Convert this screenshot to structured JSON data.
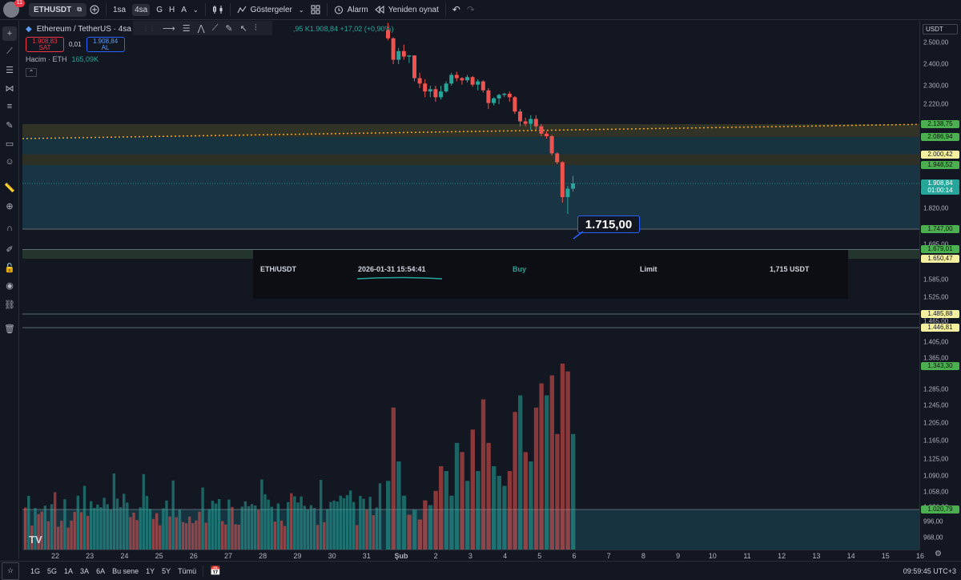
{
  "header": {
    "badge_count": "11",
    "symbol": "ETHUSDT",
    "timeframes": [
      "1sa",
      "4sa",
      "G",
      "H",
      "A"
    ],
    "active_timeframe": "4sa",
    "indicators_label": "Göstergeler",
    "alarm_label": "Alarm",
    "replay_label": "Yeniden oynat"
  },
  "legend": {
    "title": "Ethereum / TetherUS · 4sa",
    "ohlc_tail": ",95 K1.908,84 +17,02 (+0,90%)",
    "sell_price": "1.908,83",
    "sell_label": "SAT",
    "spread": "0,01",
    "buy_price": "1.908,84",
    "buy_label": "AL",
    "volume_label": "Hacim · ETH",
    "volume_value": "165,09K"
  },
  "axis": {
    "currency": "USDT",
    "labels": [
      "2.500,00",
      "2.400,00",
      "2.300,00",
      "2.220,00",
      "2.080,00",
      "1.950,00",
      "1.820,00",
      "1.695,00",
      "1.585,00",
      "1.525,00",
      "1.465,00",
      "1.405,00",
      "1.365,00",
      "1.285,00",
      "1.245,00",
      "1.205,00",
      "1.165,00",
      "1.125,00",
      "1.090,00",
      "1.058,00",
      "1.026,00",
      "996,00",
      "968,00"
    ],
    "badges": [
      {
        "text": "2.138,75",
        "kind": "green"
      },
      {
        "text": "2.086,94",
        "kind": "green"
      },
      {
        "text": "2.000,42",
        "kind": "yellow"
      },
      {
        "text": "1.948,52",
        "kind": "green"
      },
      {
        "text": "1.908,84",
        "kind": "teal"
      },
      {
        "text": "01:00:14",
        "kind": "teal"
      },
      {
        "text": "1.747,00",
        "kind": "green"
      },
      {
        "text": "1.679,01",
        "kind": "green"
      },
      {
        "text": "1.650,47",
        "kind": "yellow"
      },
      {
        "text": "1.485,88",
        "kind": "yellow"
      },
      {
        "text": "1.446,81",
        "kind": "yellow"
      },
      {
        "text": "1.343,30",
        "kind": "green"
      },
      {
        "text": "1.020,79",
        "kind": "green"
      }
    ]
  },
  "xaxis": [
    "22",
    "23",
    "24",
    "25",
    "26",
    "27",
    "28",
    "29",
    "30",
    "31",
    "Şub",
    "2",
    "3",
    "4",
    "5",
    "6",
    "7",
    "8",
    "9",
    "10",
    "11",
    "12",
    "13",
    "14",
    "15",
    "16"
  ],
  "callout": "1.715,00",
  "order": {
    "pair": "ETH/USDT",
    "datetime": "2026-01-31 15:54:41",
    "side": "Buy",
    "type": "Limit",
    "amount": "1,715 USDT"
  },
  "footer": {
    "ranges": [
      "1G",
      "5G",
      "1A",
      "3A",
      "6A",
      "Bu sene",
      "1Y",
      "5Y",
      "Tümü"
    ],
    "clock": "09:59:45 UTC+3"
  },
  "colors": {
    "up": "#26a69a",
    "down": "#ef5350",
    "zone_teal": "#1e4a5a",
    "zone_yellow": "#4a4a2a",
    "accent": "#2962ff"
  },
  "chart_data": {
    "type": "candlestick",
    "candles": [
      {
        "o": 2560,
        "h": 2595,
        "l": 2510,
        "c": 2520
      },
      {
        "o": 2520,
        "h": 2525,
        "l": 2400,
        "c": 2420
      },
      {
        "o": 2420,
        "h": 2475,
        "l": 2400,
        "c": 2460
      },
      {
        "o": 2460,
        "h": 2490,
        "l": 2420,
        "c": 2435
      },
      {
        "o": 2435,
        "h": 2440,
        "l": 2405,
        "c": 2440
      },
      {
        "o": 2440,
        "h": 2440,
        "l": 2320,
        "c": 2335
      },
      {
        "o": 2335,
        "h": 2360,
        "l": 2290,
        "c": 2310
      },
      {
        "o": 2310,
        "h": 2330,
        "l": 2250,
        "c": 2275
      },
      {
        "o": 2275,
        "h": 2300,
        "l": 2250,
        "c": 2285
      },
      {
        "o": 2285,
        "h": 2300,
        "l": 2230,
        "c": 2250
      },
      {
        "o": 2250,
        "h": 2300,
        "l": 2240,
        "c": 2275
      },
      {
        "o": 2275,
        "h": 2320,
        "l": 2270,
        "c": 2310
      },
      {
        "o": 2310,
        "h": 2360,
        "l": 2300,
        "c": 2350
      },
      {
        "o": 2350,
        "h": 2365,
        "l": 2320,
        "c": 2335
      },
      {
        "o": 2335,
        "h": 2340,
        "l": 2305,
        "c": 2325
      },
      {
        "o": 2325,
        "h": 2350,
        "l": 2315,
        "c": 2340
      },
      {
        "o": 2340,
        "h": 2345,
        "l": 2295,
        "c": 2305
      },
      {
        "o": 2305,
        "h": 2330,
        "l": 2280,
        "c": 2320
      },
      {
        "o": 2320,
        "h": 2325,
        "l": 2270,
        "c": 2280
      },
      {
        "o": 2280,
        "h": 2290,
        "l": 2200,
        "c": 2225
      },
      {
        "o": 2225,
        "h": 2250,
        "l": 2215,
        "c": 2245
      },
      {
        "o": 2245,
        "h": 2265,
        "l": 2220,
        "c": 2260
      },
      {
        "o": 2260,
        "h": 2270,
        "l": 2250,
        "c": 2265
      },
      {
        "o": 2265,
        "h": 2275,
        "l": 2230,
        "c": 2250
      },
      {
        "o": 2250,
        "h": 2255,
        "l": 2180,
        "c": 2190
      },
      {
        "o": 2190,
        "h": 2200,
        "l": 2130,
        "c": 2150
      },
      {
        "o": 2150,
        "h": 2165,
        "l": 2130,
        "c": 2140
      },
      {
        "o": 2140,
        "h": 2175,
        "l": 2115,
        "c": 2160
      },
      {
        "o": 2160,
        "h": 2175,
        "l": 2115,
        "c": 2130
      },
      {
        "o": 2130,
        "h": 2140,
        "l": 2090,
        "c": 2100
      },
      {
        "o": 2100,
        "h": 2110,
        "l": 2080,
        "c": 2090
      },
      {
        "o": 2090,
        "h": 2095,
        "l": 1995,
        "c": 2005
      },
      {
        "o": 2005,
        "h": 2010,
        "l": 1950,
        "c": 1960
      },
      {
        "o": 1960,
        "h": 1965,
        "l": 1840,
        "c": 1860
      },
      {
        "o": 1860,
        "h": 1900,
        "l": 1800,
        "c": 1890
      },
      {
        "o": 1890,
        "h": 1925,
        "l": 1880,
        "c": 1908.84
      }
    ],
    "volumes": [
      {
        "v": 1080,
        "up": true
      },
      {
        "v": 1240,
        "up": false
      },
      {
        "v": 1120,
        "up": true
      },
      {
        "v": 1050,
        "up": true
      },
      {
        "v": 1010,
        "up": false
      },
      {
        "v": 1020,
        "up": true
      },
      {
        "v": 1000,
        "up": false
      },
      {
        "v": 1040,
        "up": false
      },
      {
        "v": 1030,
        "up": true
      },
      {
        "v": 1060,
        "up": false
      },
      {
        "v": 1110,
        "up": false
      },
      {
        "v": 1100,
        "up": true
      },
      {
        "v": 1050,
        "up": true
      },
      {
        "v": 1160,
        "up": true
      },
      {
        "v": 1140,
        "up": false
      },
      {
        "v": 1080,
        "up": true
      },
      {
        "v": 1190,
        "up": false
      },
      {
        "v": 1100,
        "up": true
      },
      {
        "v": 1260,
        "up": false
      },
      {
        "v": 1160,
        "up": false
      },
      {
        "v": 1110,
        "up": true
      },
      {
        "v": 1090,
        "up": true
      },
      {
        "v": 1070,
        "up": true
      },
      {
        "v": 1100,
        "up": false
      },
      {
        "v": 1230,
        "up": false
      },
      {
        "v": 1270,
        "up": true
      },
      {
        "v": 1140,
        "up": false
      },
      {
        "v": 1120,
        "up": true
      },
      {
        "v": 1240,
        "up": false
      },
      {
        "v": 1300,
        "up": false
      },
      {
        "v": 1270,
        "up": true
      },
      {
        "v": 1320,
        "up": false
      },
      {
        "v": 1180,
        "up": false
      },
      {
        "v": 1350,
        "up": false
      },
      {
        "v": 1330,
        "up": false
      },
      {
        "v": 1180,
        "up": true
      }
    ],
    "ylim": [
      940,
      2620
    ],
    "xlim_days": [
      "22",
      "16"
    ]
  }
}
